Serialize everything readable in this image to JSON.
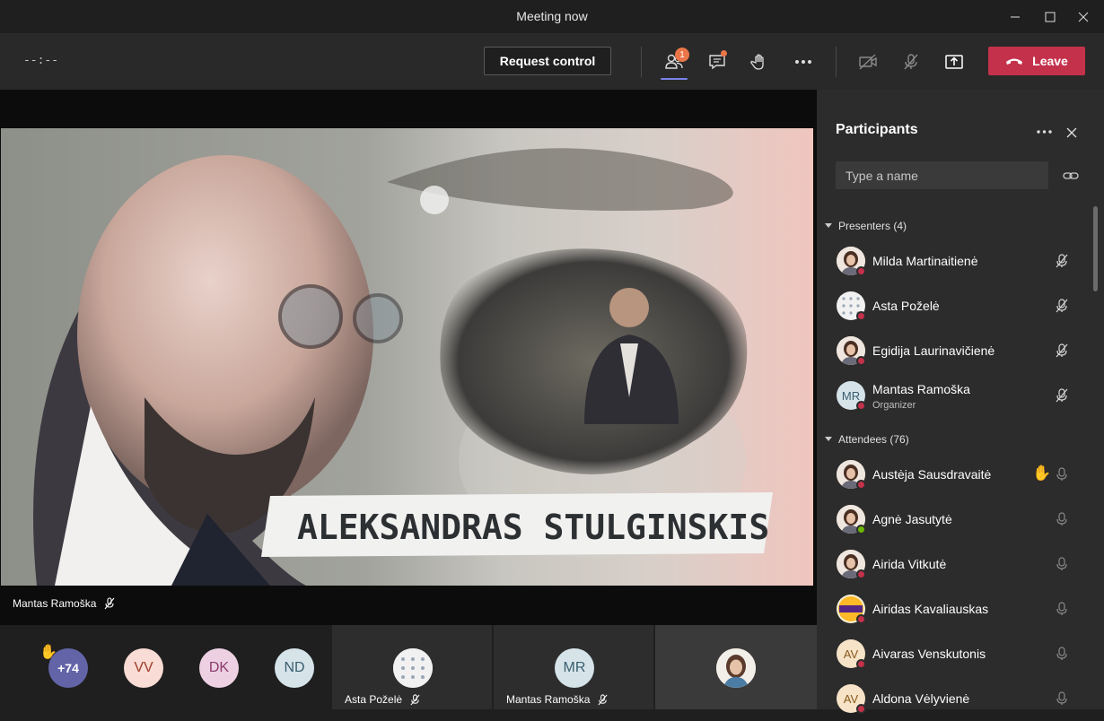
{
  "window": {
    "title": "Meeting now"
  },
  "toolbar": {
    "timer": "--:--",
    "request_control": "Request control",
    "participants_badge": "1",
    "leave": "Leave"
  },
  "stage": {
    "slide_title": "ALEKSANDRAS STULGINSKIS",
    "presenter_name": "Mantas Ramoška"
  },
  "strip": {
    "overflow_count": "+74",
    "avatars": [
      {
        "initials": "VV",
        "bg": "#f9dcd5",
        "fg": "#9c3c2a"
      },
      {
        "initials": "DK",
        "bg": "#edd1e3",
        "fg": "#8c3a6b"
      },
      {
        "initials": "ND",
        "bg": "#d6e4ea",
        "fg": "#3a5e6e"
      }
    ],
    "tiles": [
      {
        "name": "Asta Poželė"
      },
      {
        "name": "Mantas Ramoška",
        "initials": "MR"
      },
      {
        "name": ""
      }
    ]
  },
  "participants": {
    "title": "Participants",
    "search_placeholder": "Type a name",
    "presenters_header": "Presenters (4)",
    "attendees_header": "Attendees (76)",
    "presenters": [
      {
        "name": "Milda Martinaitienė",
        "avatar": "photo",
        "status": "busy"
      },
      {
        "name": "Asta Poželė",
        "avatar": "pattern",
        "status": "busy"
      },
      {
        "name": "Egidija Laurinavičienė",
        "avatar": "photo",
        "status": "busy"
      },
      {
        "name": "Mantas Ramoška",
        "initials": "MR",
        "role": "Organizer",
        "status": "dnd"
      }
    ],
    "attendees": [
      {
        "name": "Austėja Sausdravaitė",
        "avatar": "photo",
        "status": "busy",
        "hand_raised": true
      },
      {
        "name": "Agnė Jasutytė",
        "avatar": "photo",
        "status": "available"
      },
      {
        "name": "Airida Vitkutė",
        "avatar": "photo",
        "status": "busy"
      },
      {
        "name": "Airidas Kavaliauskas",
        "avatar": "logo",
        "status": "busy"
      },
      {
        "name": "Aivaras Venskutonis",
        "initials": "AV",
        "status": "busy"
      },
      {
        "name": "Aldona Vėlyvienė",
        "initials": "AV",
        "status": "busy"
      }
    ]
  },
  "colors": {
    "accent": "#7b83eb",
    "leave": "#c4314b",
    "busy": "#c4314b",
    "available": "#6bb700",
    "badge": "#e97548"
  }
}
